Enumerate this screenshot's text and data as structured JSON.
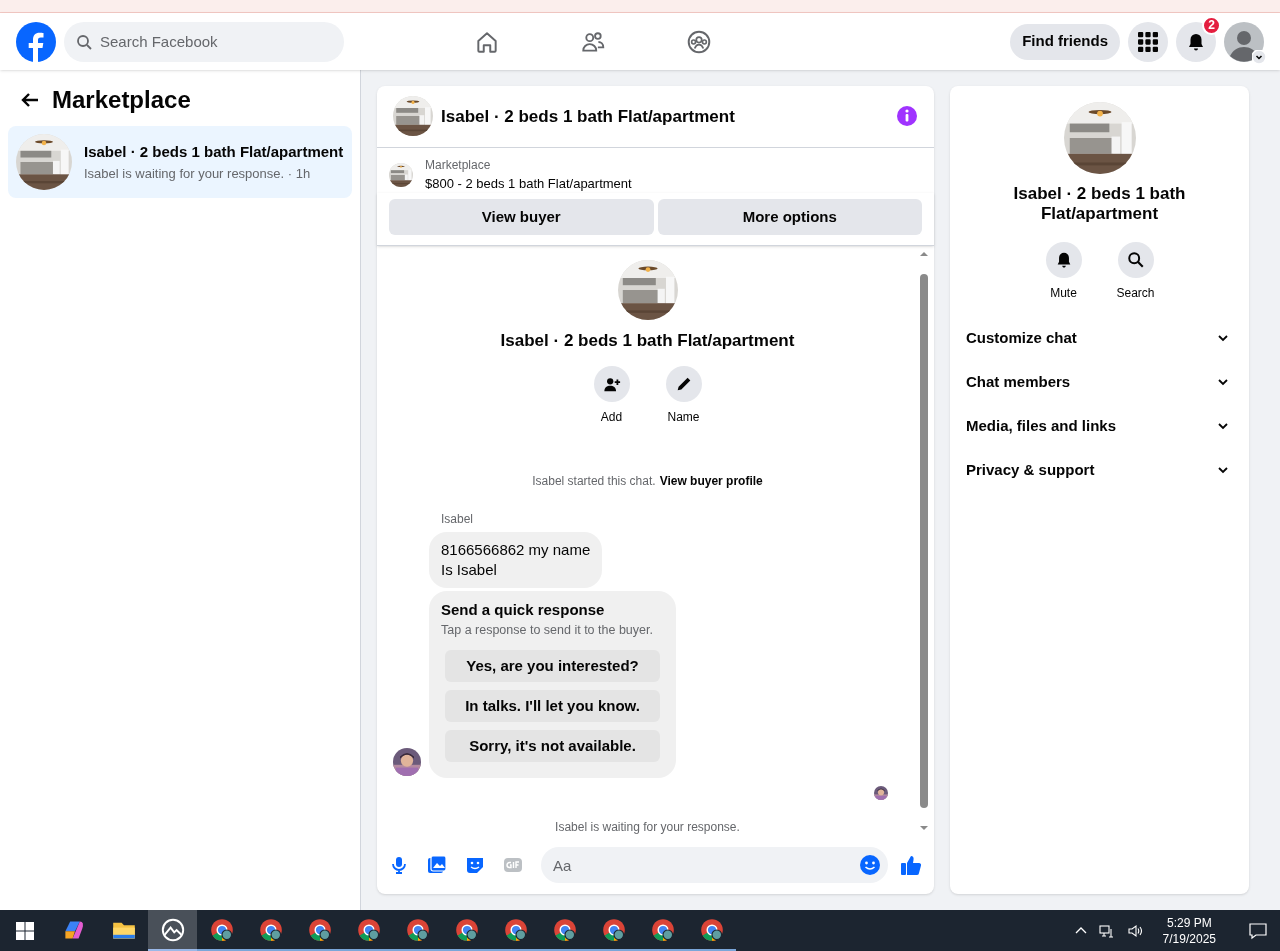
{
  "header": {
    "search_placeholder": "Search Facebook",
    "nav": [
      {
        "kind": "home"
      },
      {
        "kind": "friends"
      },
      {
        "kind": "groups"
      }
    ],
    "find_friends": "Find friends",
    "notification_count": "2"
  },
  "sidebar": {
    "title": "Marketplace",
    "conversations": [
      {
        "title": "Isabel · 2 beds 1 bath Flat/apartment",
        "subtitle": "Isabel is waiting for your response. · 1h",
        "selected": true
      }
    ]
  },
  "chat": {
    "title": "Isabel · 2 beds 1 bath Flat/apartment",
    "listing": {
      "label": "Marketplace",
      "text": "$800 - 2 beds 1 bath Flat/apartment"
    },
    "buttons": [
      "View buyer",
      "More options"
    ],
    "intro": {
      "title": "Isabel · 2 beds 1 bath Flat/apartment",
      "actions": [
        {
          "kind": "add",
          "label": "Add"
        },
        {
          "kind": "name",
          "label": "Name"
        }
      ]
    },
    "started": "Isabel started this chat.",
    "started_link": "View buyer profile",
    "sender": "Isabel",
    "message_lines": [
      "8166566862 my name",
      "Is Isabel"
    ],
    "quick_response": {
      "title": "Send a quick response",
      "subtitle": "Tap a response to send it to the buyer.",
      "options": [
        "Yes, are you interested?",
        "In talks. I'll let you know.",
        "Sorry, it's not available."
      ]
    },
    "status": "Isabel is waiting for your response.",
    "composer_placeholder": "Aa"
  },
  "details": {
    "title": "Isabel · 2 beds 1 bath Flat/apartment",
    "actions": [
      {
        "kind": "mute",
        "label": "Mute"
      },
      {
        "kind": "search",
        "label": "Search"
      }
    ],
    "sections": [
      {
        "label": "Customize chat",
        "expanded": false
      },
      {
        "label": "Chat members",
        "expanded": false
      },
      {
        "label": "Media, files and links",
        "expanded": false
      },
      {
        "label": "Privacy & support",
        "expanded": false
      }
    ]
  },
  "taskbar": {
    "apps": [
      {
        "kind": "copilot",
        "selected": false
      },
      {
        "kind": "files",
        "selected": false
      },
      {
        "kind": "photos",
        "selected": true
      },
      {
        "kind": "browser",
        "selected": false
      },
      {
        "kind": "browser",
        "selected": false
      },
      {
        "kind": "browser",
        "selected": false
      },
      {
        "kind": "browser",
        "selected": false
      },
      {
        "kind": "browser",
        "selected": false
      },
      {
        "kind": "browser",
        "selected": false
      },
      {
        "kind": "browser",
        "selected": false
      },
      {
        "kind": "browser",
        "selected": false
      },
      {
        "kind": "browser",
        "selected": false
      },
      {
        "kind": "browser",
        "selected": false
      },
      {
        "kind": "browser",
        "selected": false
      }
    ],
    "time": "5:29 PM",
    "date": "7/19/2025"
  }
}
